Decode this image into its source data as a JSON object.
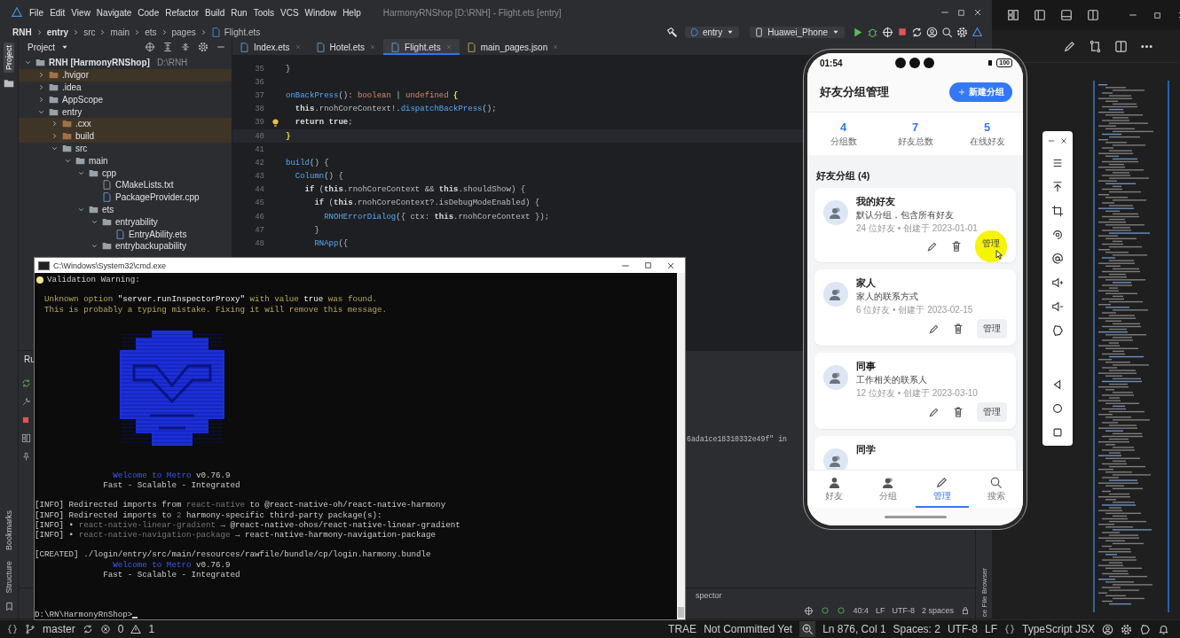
{
  "background_editor": {
    "status": {
      "branch": "master",
      "errors": "0",
      "warnings": "1",
      "items": [
        {
          "text": "TRAE",
          "kind": "plain"
        },
        {
          "text": "Not Committed Yet",
          "kind": "plain"
        },
        {
          "text": "Ln 876, Col 1",
          "kind": "plain"
        },
        {
          "text": "Spaces: 2",
          "kind": "plain"
        },
        {
          "text": "UTF-8",
          "kind": "plain"
        },
        {
          "text": "LF",
          "kind": "plain"
        },
        {
          "text": "TypeScript JSX",
          "kind": "language"
        }
      ]
    }
  },
  "ide": {
    "title": "HarmonyRNShop [D:\\RNH] - Flight.ets [entry]",
    "menu": [
      "File",
      "Edit",
      "View",
      "Navigate",
      "Code",
      "Refactor",
      "Build",
      "Run",
      "Tools",
      "VCS",
      "Window",
      "Help"
    ],
    "breadcrumb": [
      "RNH",
      "entry",
      "src",
      "main",
      "ets",
      "pages",
      "Flight.ets"
    ],
    "run_config": "entry",
    "device": "Huawei_Phone",
    "side_tabs": [
      {
        "label": "Project",
        "selected": true
      }
    ],
    "lower_side_tabs": [
      "Bookmarks",
      "Structure"
    ],
    "project_panel": {
      "title": "Project",
      "tree": [
        {
          "label": "RNH [HarmonyRNShop]",
          "path": "D:\\RNH",
          "kind": "module",
          "expanded": true,
          "children": [
            {
              "label": ".hvigor",
              "kind": "excluded",
              "expanded": false
            },
            {
              "label": ".idea",
              "kind": "folder",
              "expanded": false
            },
            {
              "label": "AppScope",
              "kind": "folder",
              "expanded": false
            },
            {
              "label": "entry",
              "kind": "module",
              "expanded": true,
              "children": [
                {
                  "label": ".cxx",
                  "kind": "excluded",
                  "expanded": false
                },
                {
                  "label": "build",
                  "kind": "excluded",
                  "expanded": false
                },
                {
                  "label": "src",
                  "kind": "folder",
                  "expanded": true,
                  "children": [
                    {
                      "label": "main",
                      "kind": "folder",
                      "expanded": true,
                      "children": [
                        {
                          "label": "cpp",
                          "kind": "folder",
                          "expanded": true,
                          "children": [
                            {
                              "label": "CMakeLists.txt",
                              "kind": "file_txt"
                            },
                            {
                              "label": "PackageProvider.cpp",
                              "kind": "file_cpp"
                            }
                          ]
                        },
                        {
                          "label": "ets",
                          "kind": "folder",
                          "expanded": true,
                          "children": [
                            {
                              "label": "entryability",
                              "kind": "folder",
                              "expanded": true,
                              "children": [
                                {
                                  "label": "EntryAbility.ets",
                                  "kind": "file_ets"
                                }
                              ]
                            },
                            {
                              "label": "entrybackupability",
                              "kind": "folder",
                              "expanded": true
                            }
                          ]
                        }
                      ]
                    }
                  ]
                }
              ]
            }
          ]
        }
      ]
    },
    "tabs": [
      {
        "label": "Index.ets",
        "kind": "ets",
        "selected": false
      },
      {
        "label": "Hotel.ets",
        "kind": "ets",
        "selected": false
      },
      {
        "label": "Flight.ets",
        "kind": "ets",
        "selected": true
      },
      {
        "label": "main_pages.json",
        "kind": "json",
        "selected": false
      }
    ],
    "code": [
      {
        "no": "35",
        "current": false,
        "hint": false,
        "tokens": [
          {
            "text": "}",
            "kind": "plain"
          }
        ]
      },
      {
        "no": "36",
        "current": false,
        "hint": false
      },
      {
        "no": "37",
        "current": false,
        "hint": false,
        "tokens": [
          {
            "text": "onBackPress",
            "kind": "fn"
          },
          {
            "text": "(): ",
            "kind": "plain"
          },
          {
            "text": "boolean",
            "kind": "kw"
          },
          {
            "text": " | ",
            "kind": "plain"
          },
          {
            "text": "undefined",
            "kind": "kw"
          },
          {
            "text": " {",
            "kind": "match"
          }
        ]
      },
      {
        "no": "38",
        "current": false,
        "hint": false,
        "tokens": [
          {
            "text": "  this",
            "kind": "strong"
          },
          {
            "text": ".rnohCoreContext!.",
            "kind": "plain"
          },
          {
            "text": "dispatchBackPress",
            "kind": "fn"
          },
          {
            "text": "();",
            "kind": "plain"
          }
        ]
      },
      {
        "no": "39",
        "current": false,
        "hint": true,
        "tokens": [
          {
            "text": "  return true",
            "kind": "strong"
          },
          {
            "text": ";",
            "kind": "plain"
          }
        ]
      },
      {
        "no": "40",
        "current": true,
        "hint": false,
        "tokens": [
          {
            "text": "}",
            "kind": "match"
          }
        ]
      },
      {
        "no": "41",
        "current": false,
        "hint": false
      },
      {
        "no": "42",
        "current": false,
        "hint": false,
        "tokens": [
          {
            "text": "build",
            "kind": "fn"
          },
          {
            "text": "() {",
            "kind": "plain"
          }
        ]
      },
      {
        "no": "43",
        "current": false,
        "hint": false,
        "tokens": [
          {
            "text": "  Column",
            "kind": "fn"
          },
          {
            "text": "() {",
            "kind": "plain"
          }
        ]
      },
      {
        "no": "44",
        "current": false,
        "hint": false,
        "tokens": [
          {
            "text": "    if",
            "kind": "strong"
          },
          {
            "text": " (",
            "kind": "plain"
          },
          {
            "text": "this",
            "kind": "strong"
          },
          {
            "text": ".rnohCoreContext && ",
            "kind": "plain"
          },
          {
            "text": "this",
            "kind": "strong"
          },
          {
            "text": ".shouldShow) {",
            "kind": "plain"
          }
        ]
      },
      {
        "no": "45",
        "current": false,
        "hint": false,
        "tokens": [
          {
            "text": "      if",
            "kind": "strong"
          },
          {
            "text": " (",
            "kind": "plain"
          },
          {
            "text": "this",
            "kind": "strong"
          },
          {
            "text": ".rnohCoreContext?.isDebugModeEnabled) {",
            "kind": "plain"
          }
        ]
      },
      {
        "no": "46",
        "current": false,
        "hint": false,
        "tokens": [
          {
            "text": "        RNOHErrorDialog",
            "kind": "fn"
          },
          {
            "text": "({ ctx: ",
            "kind": "plain"
          },
          {
            "text": "this",
            "kind": "strong"
          },
          {
            "text": ".rnohCoreContext });",
            "kind": "plain"
          }
        ]
      },
      {
        "no": "47",
        "current": false,
        "hint": false,
        "tokens": [
          {
            "text": "      }",
            "kind": "plain"
          }
        ]
      },
      {
        "no": "48",
        "current": false,
        "hint": false,
        "tokens": [
          {
            "text": "      RNApp",
            "kind": "fn"
          },
          {
            "text": "({",
            "kind": "plain"
          }
        ]
      }
    ],
    "run_panel": {
      "title": "Ru",
      "output": "6ada1ce18310332e49f\" in"
    },
    "right_tool": "ce File Browser",
    "tool_tab": "spector",
    "status": [
      "40:4",
      "LF",
      "UTF-8",
      "2 spaces"
    ]
  },
  "console": {
    "title": "C:\\Windows\\System32\\cmd.exe",
    "entries": [
      {
        "kind": "warning",
        "segments": [
          {
            "text": "Validation Warning:",
            "kind": "plain"
          }
        ]
      },
      {
        "kind": "blank"
      },
      {
        "kind": "line",
        "segments": [
          {
            "text": "  Unknown option ",
            "kind": "warn"
          },
          {
            "text": "\"server.runInspectorProxy\"",
            "kind": "warn_strong"
          },
          {
            "text": " with value ",
            "kind": "warn"
          },
          {
            "text": "true",
            "kind": "warn_strong"
          },
          {
            "text": " was found.",
            "kind": "warn"
          }
        ]
      },
      {
        "kind": "line",
        "segments": [
          {
            "text": "  This is probably a typing mistake. Fixing it will remove this message.",
            "kind": "warn"
          }
        ]
      },
      {
        "kind": "logo"
      },
      {
        "kind": "line",
        "segments": [
          {
            "text": "                Welcome to Metro",
            "kind": "blue"
          },
          {
            "text": " v0.76.9",
            "kind": "plain"
          }
        ]
      },
      {
        "kind": "line",
        "segments": [
          {
            "text": "              Fast - Scalable - Integrated",
            "kind": "plain"
          }
        ]
      },
      {
        "kind": "blank"
      },
      {
        "kind": "line",
        "segments": [
          {
            "text": "[INFO] Redirected imports from ",
            "kind": "plain"
          },
          {
            "text": "react-native",
            "kind": "dim"
          },
          {
            "text": " to @react-native-oh/react-native-harmony",
            "kind": "plain"
          }
        ]
      },
      {
        "kind": "line",
        "segments": [
          {
            "text": "[INFO] Redirected imports to ",
            "kind": "plain"
          },
          {
            "text": "2",
            "kind": "dim"
          },
          {
            "text": " harmony-specific third-party package(s):",
            "kind": "plain"
          }
        ]
      },
      {
        "kind": "line",
        "segments": [
          {
            "text": "[INFO] • ",
            "kind": "plain"
          },
          {
            "text": "react-native-linear-gradient",
            "kind": "dim"
          },
          {
            "text": " → @react-native-ohos/react-native-linear-gradient",
            "kind": "plain"
          }
        ]
      },
      {
        "kind": "line",
        "segments": [
          {
            "text": "[INFO] • ",
            "kind": "plain"
          },
          {
            "text": "react-native-navigation-package",
            "kind": "dim"
          },
          {
            "text": " → react-native-harmony-navigation-package",
            "kind": "plain"
          }
        ]
      },
      {
        "kind": "blank"
      },
      {
        "kind": "line",
        "segments": [
          {
            "text": "[CREATED] ./login/entry/src/main/resources/rawfile/bundle/cp/login.harmony.bundle",
            "kind": "plain"
          }
        ]
      },
      {
        "kind": "line",
        "segments": [
          {
            "text": "                Welcome to Metro",
            "kind": "blue"
          },
          {
            "text": " v0.76.9",
            "kind": "plain"
          }
        ]
      },
      {
        "kind": "line",
        "segments": [
          {
            "text": "              Fast - Scalable - Integrated",
            "kind": "plain"
          }
        ]
      }
    ],
    "prompt": "D:\\RN\\HarmonyRnShop>"
  },
  "phone": {
    "time": "01:54",
    "battery": "100",
    "title": "好友分组管理",
    "new_button": "新建分组",
    "stats": [
      {
        "value": "4",
        "label": "分组数"
      },
      {
        "value": "7",
        "label": "好友总数"
      },
      {
        "value": "5",
        "label": "在线好友"
      }
    ],
    "section_title": "好友分组 (4)",
    "groups": [
      {
        "name": "我的好友",
        "description": "默认分组，包含所有好友",
        "meta": "24 位好友 • 创建于 2023-01-01",
        "manage": "管理",
        "touched": true
      },
      {
        "name": "家人",
        "description": "家人的联系方式",
        "meta": "6 位好友 • 创建于 2023-02-15",
        "manage": "管理",
        "touched": false
      },
      {
        "name": "同事",
        "description": "工作相关的联系人",
        "meta": "12 位好友 • 创建于 2023-03-10",
        "manage": "管理",
        "touched": false
      },
      {
        "name": "同学"
      }
    ],
    "tabs": [
      {
        "label": "好友",
        "kind": "person",
        "selected": false
      },
      {
        "label": "分组",
        "kind": "group",
        "selected": false
      },
      {
        "label": "管理",
        "kind": "pencil",
        "selected": true
      },
      {
        "label": "搜索",
        "kind": "search",
        "selected": false
      }
    ]
  }
}
